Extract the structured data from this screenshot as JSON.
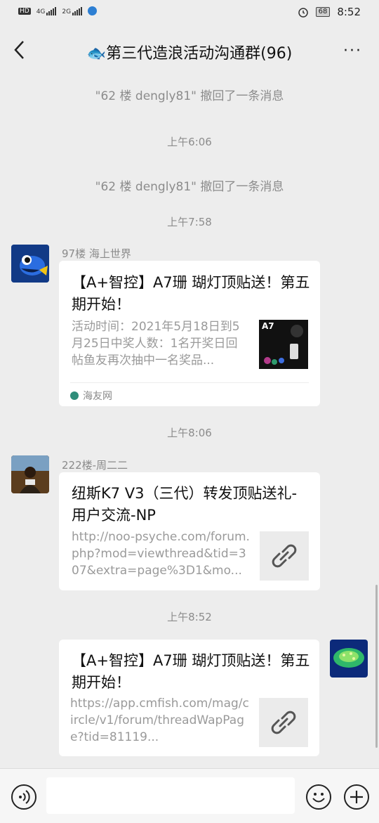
{
  "status": {
    "left": [
      "HD",
      "4G",
      "2G"
    ],
    "battery": "68",
    "time": "8:52"
  },
  "header": {
    "title": "🐟第三代造浪活动沟通群(96)",
    "more": "···"
  },
  "messages": {
    "sys1": "\"62 楼 dengly81\" 撤回了一条消息",
    "t1": "上午6:06",
    "sys2": "\"62 楼 dengly81\" 撤回了一条消息",
    "t2": "上午7:58",
    "m1": {
      "sender": "97楼  海上世界",
      "title": "【A+智控】A7珊 瑚灯顶贴送！第五期开始！",
      "desc": "活动时间：2021年5月18日到5月25日中奖人数：1名开奖日回帖鱼友再次抽中一名奖品...",
      "thumb_label": "A7",
      "source": "海友网"
    },
    "t3": "上午8:06",
    "m2": {
      "sender": "222楼-周二二",
      "title": "纽斯K7 V3（三代）转发顶贴送礼- 用户交流-NP",
      "desc": "http://noo-psyche.com/forum.php?mod=viewthread&tid=307&extra=page%3D1&mo..."
    },
    "t4": "上午8:52",
    "m3": {
      "title": "【A+智控】A7珊 瑚灯顶贴送！第五期开始！",
      "desc": "https://app.cmfish.com/mag/circle/v1/forum/threadWapPage?tid=81119..."
    }
  },
  "colors": {
    "background": "#ededed",
    "card": "#ffffff",
    "muted": "#8c8c8c"
  },
  "icons": {
    "back": "chevron-left-icon",
    "voice": "voice-icon",
    "emoji": "emoji-icon",
    "add": "plus-icon",
    "link": "link-icon"
  }
}
